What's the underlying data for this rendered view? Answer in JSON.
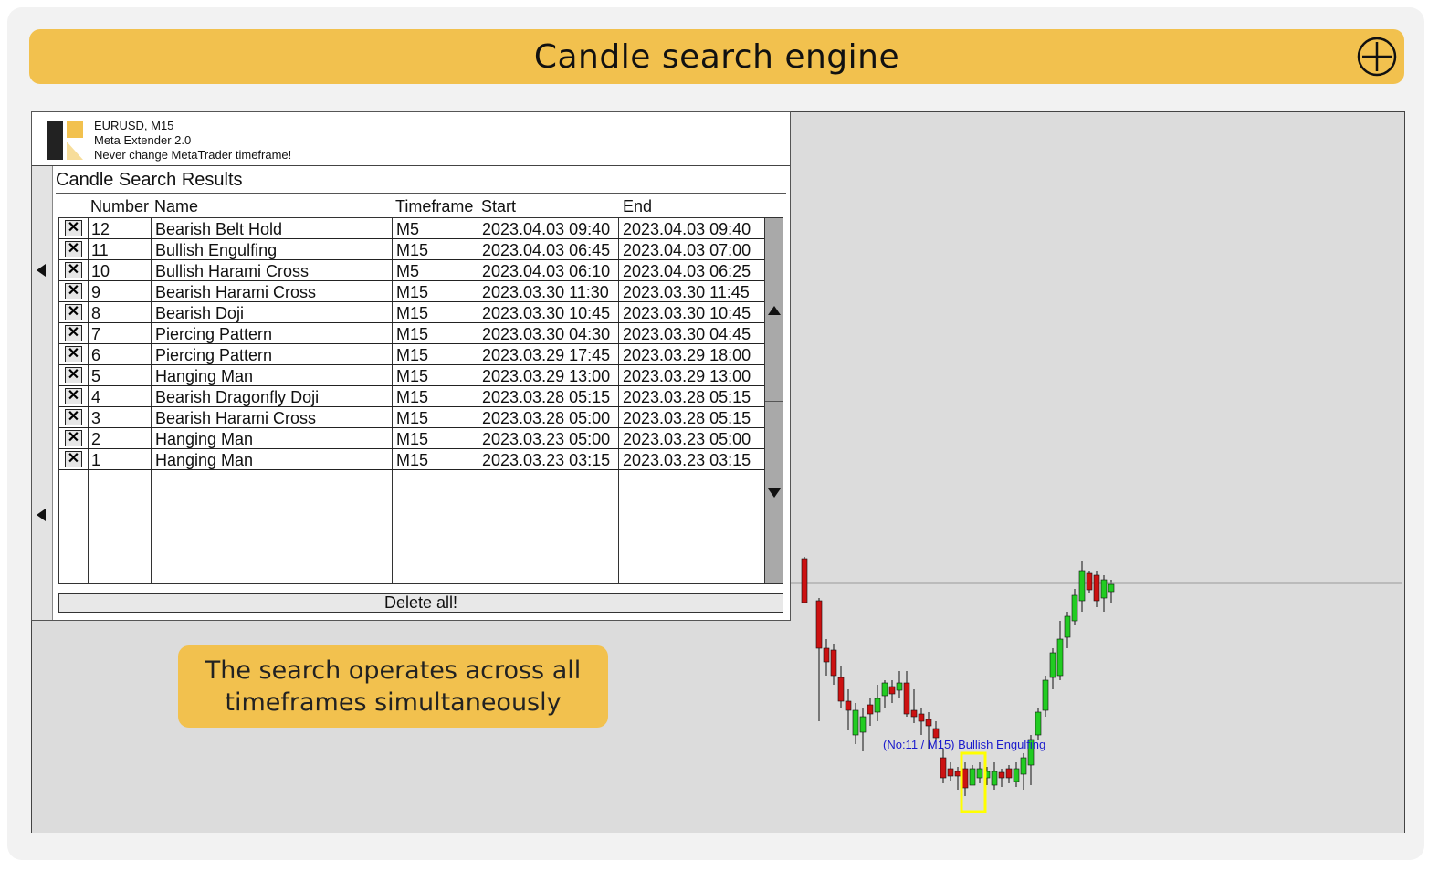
{
  "banner": {
    "title": "Candle search engine",
    "icon": "plus-circle-icon"
  },
  "panel": {
    "header_lines": [
      "EURUSD, M15",
      "Meta Extender 2.0",
      "Never change MetaTrader timeframe!"
    ],
    "results_title": "Candle Search Results",
    "columns": [
      "Number",
      "Name",
      "Timeframe",
      "Start",
      "End"
    ],
    "delete_icon": "x",
    "rows": [
      {
        "number": "12",
        "name": "Bearish Belt Hold",
        "timeframe": "M5",
        "start": "2023.04.03 09:40",
        "end": "2023.04.03 09:40"
      },
      {
        "number": "11",
        "name": "Bullish Engulfing",
        "timeframe": "M15",
        "start": "2023.04.03 06:45",
        "end": "2023.04.03 07:00"
      },
      {
        "number": "10",
        "name": "Bullish Harami Cross",
        "timeframe": "M5",
        "start": "2023.04.03 06:10",
        "end": "2023.04.03 06:25"
      },
      {
        "number": "9",
        "name": "Bearish Harami Cross",
        "timeframe": "M15",
        "start": "2023.03.30 11:30",
        "end": "2023.03.30 11:45"
      },
      {
        "number": "8",
        "name": "Bearish Doji",
        "timeframe": "M15",
        "start": "2023.03.30 10:45",
        "end": "2023.03.30 10:45"
      },
      {
        "number": "7",
        "name": "Piercing Pattern",
        "timeframe": "M15",
        "start": "2023.03.30 04:30",
        "end": "2023.03.30 04:45"
      },
      {
        "number": "6",
        "name": "Piercing Pattern",
        "timeframe": "M15",
        "start": "2023.03.29 17:45",
        "end": "2023.03.29 18:00"
      },
      {
        "number": "5",
        "name": "Hanging Man",
        "timeframe": "M15",
        "start": "2023.03.29 13:00",
        "end": "2023.03.29 13:00"
      },
      {
        "number": "4",
        "name": "Bearish Dragonfly Doji",
        "timeframe": "M15",
        "start": "2023.03.28 05:15",
        "end": "2023.03.28 05:15"
      },
      {
        "number": "3",
        "name": "Bearish Harami Cross",
        "timeframe": "M15",
        "start": "2023.03.28 05:00",
        "end": "2023.03.28 05:15"
      },
      {
        "number": "2",
        "name": "Hanging Man",
        "timeframe": "M15",
        "start": "2023.03.23 05:00",
        "end": "2023.03.23 05:00"
      },
      {
        "number": "1",
        "name": "Hanging Man",
        "timeframe": "M15",
        "start": "2023.03.23 03:15",
        "end": "2023.03.23 03:15"
      }
    ],
    "delete_all_label": "Delete all!"
  },
  "callout": {
    "line1": "The search operates across all",
    "line2": "timeframes simultaneously"
  },
  "chart": {
    "pattern_label": "(No:11 / M15) Bullish Engulfing",
    "colors": {
      "bull": "#22cc22",
      "bear": "#cc1111",
      "highlight": "#ffff00",
      "label": "#1a1acc"
    }
  }
}
